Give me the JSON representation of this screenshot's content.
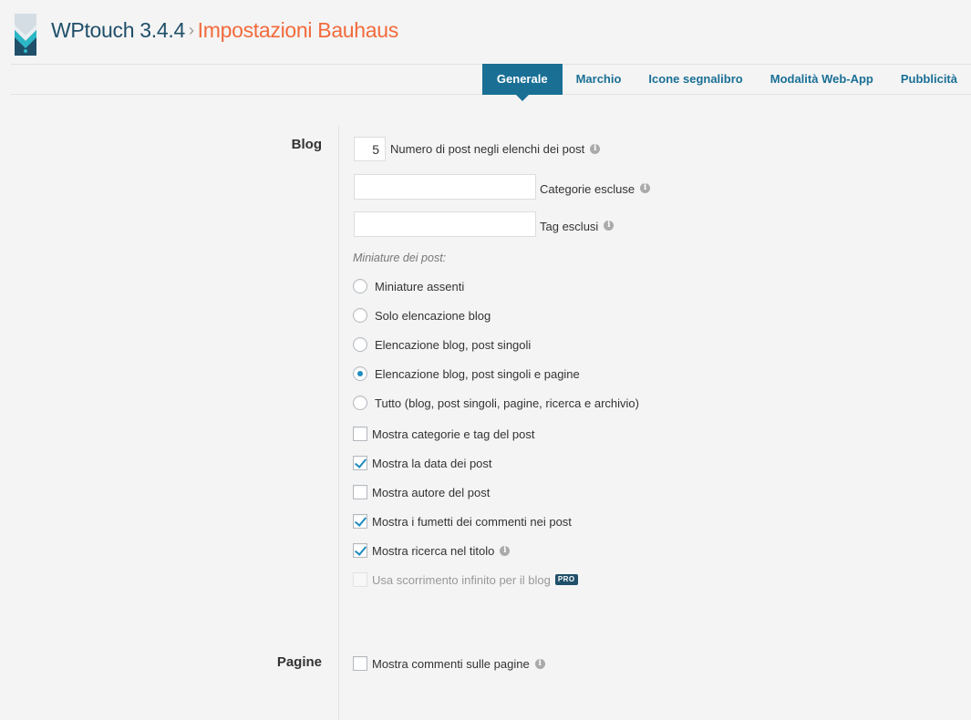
{
  "header": {
    "app_name": "WPtouch 3.4.4",
    "separator": "›",
    "page_title": "Impostazioni Bauhaus"
  },
  "tabs": [
    {
      "label": "Generale",
      "active": true
    },
    {
      "label": "Marchio",
      "active": false
    },
    {
      "label": "Icone segnalibro",
      "active": false
    },
    {
      "label": "Modalità Web-App",
      "active": false
    },
    {
      "label": "Pubblicità",
      "active": false
    }
  ],
  "blog": {
    "section_label": "Blog",
    "posts_count": {
      "value": "5",
      "label": "Numero di post negli elenchi dei post"
    },
    "excluded_categories": {
      "value": "",
      "label": "Categorie escluse"
    },
    "excluded_tags": {
      "value": "",
      "label": "Tag esclusi"
    },
    "thumbnails_heading": "Miniature dei post:",
    "thumbnail_options": [
      {
        "label": "Miniature assenti",
        "checked": false
      },
      {
        "label": "Solo elencazione blog",
        "checked": false
      },
      {
        "label": "Elencazione blog, post singoli",
        "checked": false
      },
      {
        "label": "Elencazione blog, post singoli e pagine",
        "checked": true
      },
      {
        "label": "Tutto (blog, post singoli, pagine, ricerca e archivio)",
        "checked": false
      }
    ],
    "checkboxes": [
      {
        "label": "Mostra categorie e tag del post",
        "checked": false
      },
      {
        "label": "Mostra la data dei post",
        "checked": true
      },
      {
        "label": "Mostra autore del post",
        "checked": false
      },
      {
        "label": "Mostra i fumetti dei commenti nei post",
        "checked": true
      },
      {
        "label": "Mostra ricerca nel titolo",
        "checked": true
      },
      {
        "label": "Usa scorrimento infinito per il blog",
        "checked": false,
        "disabled": true
      }
    ],
    "pro_badge": "PRO"
  },
  "pages": {
    "section_label": "Pagine",
    "show_comments": {
      "label": "Mostra commenti sulle pagine",
      "checked": false
    }
  },
  "icons": {
    "info": "info-icon",
    "logo": "wptouch-logo"
  },
  "colors": {
    "accent": "#1a6f95",
    "title_orange": "#f26a3c",
    "title_dark": "#1f4f69",
    "check_blue": "#1e8cbe"
  }
}
